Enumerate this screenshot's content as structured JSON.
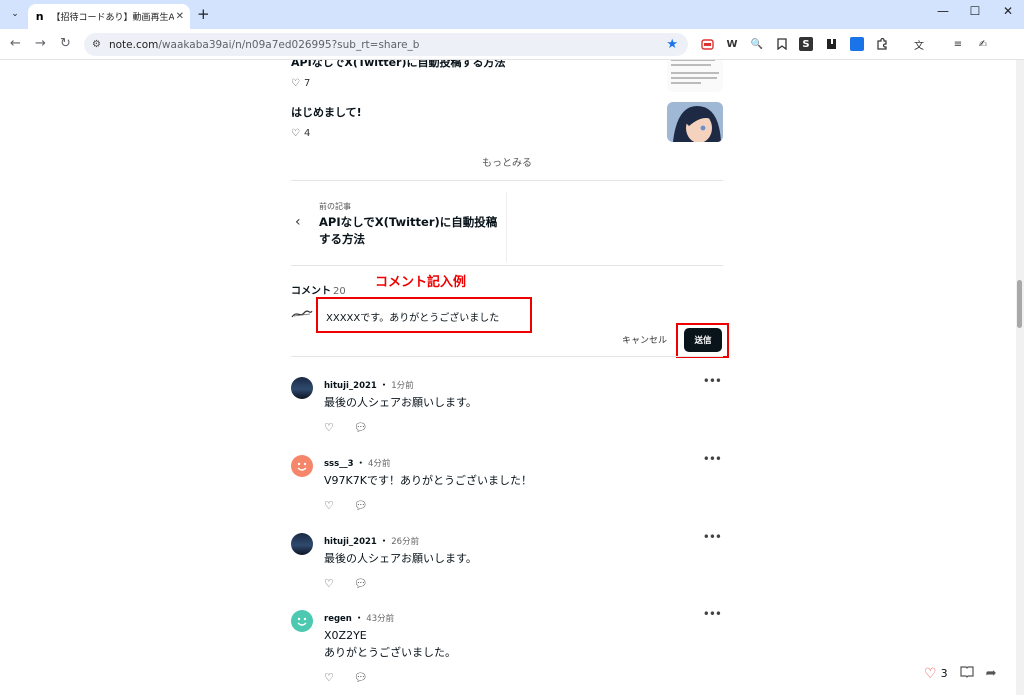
{
  "browser": {
    "tab_title": "【招待コードあり】動画再生AI「Sora",
    "tab_favicon": "n",
    "url_host": "note.com",
    "url_path": "/waakaba39ai/n/n09a7ed026995?sub_rt=share_b",
    "extensions": [
      "pdf-icon",
      "W",
      "magnifier-icon",
      "bookmark-icon",
      "S",
      "book-icon",
      "grid-icon",
      "puzzle-icon",
      "translate-icon",
      "list-icon",
      "signature-icon"
    ],
    "extension_labels": [
      "W",
      "S"
    ]
  },
  "related": [
    {
      "title": "APIなしでX(Twitter)に自動投稿する方法",
      "likes": "7"
    },
    {
      "title": "はじめまして!",
      "likes": "4"
    }
  ],
  "more_label": "もっとみる",
  "prev_article": {
    "label": "前の記事",
    "title": "APIなしでX(Twitter)に自動投稿する方法"
  },
  "comments_section": {
    "heading": "コメント",
    "count": "20",
    "annotation": "コメント記入例",
    "input_value": "XXXXXです。ありがとうございました",
    "cancel_label": "キャンセル",
    "send_label": "送信"
  },
  "comments": [
    {
      "user": "hituji_2021",
      "time": "1分前",
      "text": "最後の人シェアお願いします。",
      "avatar": "night"
    },
    {
      "user": "sss__3",
      "time": "4分前",
      "text": "V97K7Kです！ありがとうございました！",
      "avatar": "orange"
    },
    {
      "user": "hituji_2021",
      "time": "26分前",
      "text": "最後の人シェアお願いします。",
      "avatar": "night"
    },
    {
      "user": "regen",
      "time": "43分前",
      "text": "X0Z2YE\nありがとうございました。",
      "avatar": "teal"
    }
  ],
  "floating": {
    "like_count": "3"
  },
  "colors": {
    "accent_red": "#ee0000",
    "send_bg": "#08131a",
    "chrome_tab": "#d3e3fd"
  }
}
